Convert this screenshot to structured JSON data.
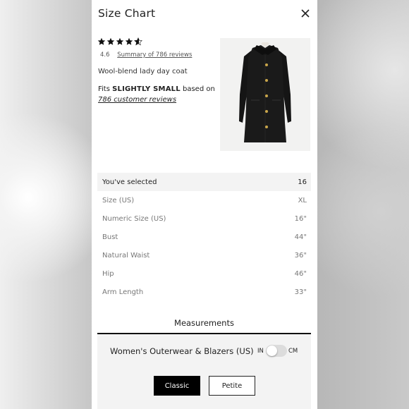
{
  "modal": {
    "title": "Size Chart"
  },
  "product": {
    "rating_value": "4.6",
    "reviews_link": "Summary of 786 reviews",
    "name": "Wool-blend lady day coat",
    "fit_prefix": "Fits",
    "fit_value": "SLIGHTLY SMALL",
    "fit_suffix": "based on",
    "fit_reviews": "786 customer reviews",
    "image_icon": "black-coat-image"
  },
  "size_table": {
    "rows": [
      {
        "label": "You've selected",
        "value": "16"
      },
      {
        "label": "Size (US)",
        "value": "XL"
      },
      {
        "label": "Numeric Size (US)",
        "value": "16\""
      },
      {
        "label": "Bust",
        "value": "44\""
      },
      {
        "label": "Natural Waist",
        "value": "36\""
      },
      {
        "label": "Hip",
        "value": "46\""
      },
      {
        "label": "Arm Length",
        "value": "33\""
      }
    ]
  },
  "measurements": {
    "tab_label": "Measurements",
    "category": "Women's Outerwear & Blazers (US)",
    "unit_in": "IN",
    "unit_cm": "CM",
    "unit_selected": "IN",
    "fit_options": [
      "Classic",
      "Petite"
    ],
    "fit_selected": "Classic"
  },
  "colors": {
    "accent": "#000000",
    "selected_row_bg": "#f3f3f3"
  }
}
